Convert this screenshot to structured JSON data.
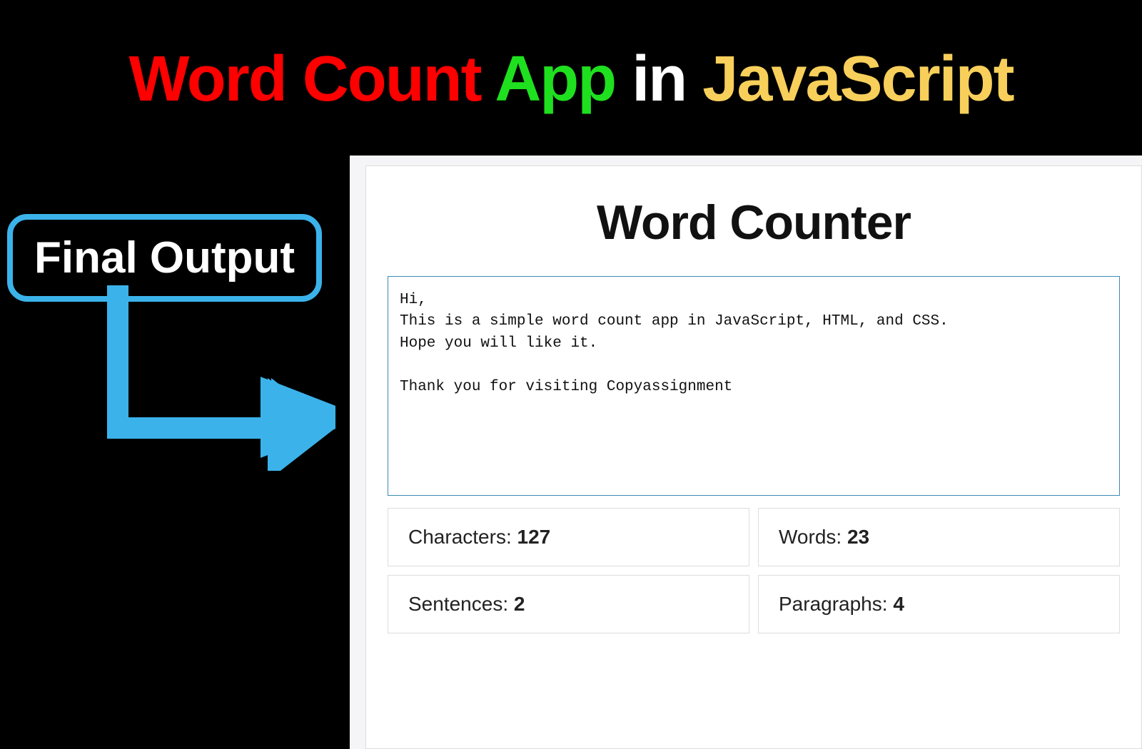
{
  "title": {
    "part1": "Word Count",
    "part2": "App",
    "part3": "in",
    "part4": "JavaScript"
  },
  "label": "Final Output",
  "app": {
    "title": "Word Counter",
    "textarea_value": "Hi,\nThis is a simple word count app in JavaScript, HTML, and CSS.\nHope you will like it.\n\nThank you for visiting Copyassignment",
    "stats": {
      "characters_label": "Characters: ",
      "characters_value": "127",
      "words_label": "Words: ",
      "words_value": "23",
      "sentences_label": "Sentences: ",
      "sentences_value": "2",
      "paragraphs_label": "Paragraphs: ",
      "paragraphs_value": "4"
    }
  },
  "colors": {
    "arrow": "#3bb3ea"
  }
}
